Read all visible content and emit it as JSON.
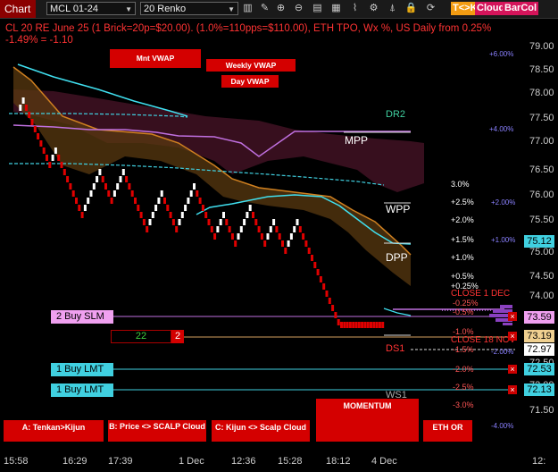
{
  "toolbar": {
    "tab": "Chart",
    "instrument": "MCL 01-24",
    "bar_type": "20 Renko",
    "icons": [
      "bars-icon",
      "pencil-icon",
      "zoom-in-icon",
      "zoom-out-icon",
      "properties-icon",
      "template-icon",
      "indicators-icon",
      "strategy-icon",
      "alert-icon",
      "lock-icon",
      "refresh-icon"
    ],
    "tk_label": "T<>K",
    "cloud_label": "Cloud",
    "barcol_label": "BarCol"
  },
  "header": {
    "line1": "CL 20 RE June 25 (1 Brick=20p=$20.00). (1.0%=110pps=$110.00), ETH TPO, Wx %, US Daily from 0.25%",
    "line2": " -1.49% = -1.10"
  },
  "vwap_buttons": {
    "mnt": "Mnt VWAP",
    "weekly": "Weekly VWAP",
    "day": "Day VWAP"
  },
  "levels": {
    "dr2": "DR2",
    "mpp": "MPP",
    "wpp": "WPP",
    "dpp": "DPP",
    "ds1": "DS1",
    "ws1": "WS1",
    "close1": "CLOSE 1 DEC",
    "close18": "CLOSE 18 NOV"
  },
  "pct_labels": [
    "3.0%",
    "+2.5%",
    "+2.0%",
    "+1.5%",
    "+1.0%",
    "+0.5%",
    "+0.25%",
    "-0.25%",
    "-0.5%",
    "-1.0%",
    "-1.5%",
    "-2.0%",
    "-2.5%",
    "-3.0%"
  ],
  "right_pct_labels": [
    "+6.00%",
    "+4.00%",
    "+2.00%",
    "+1.00%",
    "-2.00%",
    "-4.00%"
  ],
  "axis": {
    "prices": [
      "79.00",
      "78.50",
      "78.00",
      "77.50",
      "77.00",
      "76.50",
      "76.00",
      "75.50",
      "75.00",
      "74.50",
      "74.00",
      "73.50",
      "73.00",
      "72.50",
      "72.00",
      "71.50"
    ],
    "times": [
      "15:58",
      "16:29",
      "17:39",
      "1 Dec",
      "12:36",
      "15:28",
      "18:12",
      "4 Dec",
      "12:"
    ]
  },
  "price_tags": {
    "t1": "75.12",
    "t2": "73.59",
    "t3": "73.19",
    "t4": "72.97",
    "t5": "72.53",
    "t6": "72.13"
  },
  "orders": {
    "buy_slm": "2 Buy SLM",
    "buy_lmt1": "1 Buy LMT",
    "buy_lmt2": "1 Buy LMT",
    "pos_qty": "22",
    "pos_badge": "2",
    "close_x": "×"
  },
  "bottom_buttons": {
    "a": "A: Tenkan>Kijun",
    "b": "B: Price <> SCALP Cloud",
    "c": "C: Kijun <> Scalp Cloud",
    "momentum": "MOMENTUM",
    "eth": "ETH OR"
  },
  "colors": {
    "up_bar": "#ffffff",
    "down_bar": "#e00000",
    "cloud": "#3a1020",
    "vwap_orange": "#d08020",
    "vwap_purple": "#c070e0",
    "dash_cyan": "#40d0e0"
  }
}
